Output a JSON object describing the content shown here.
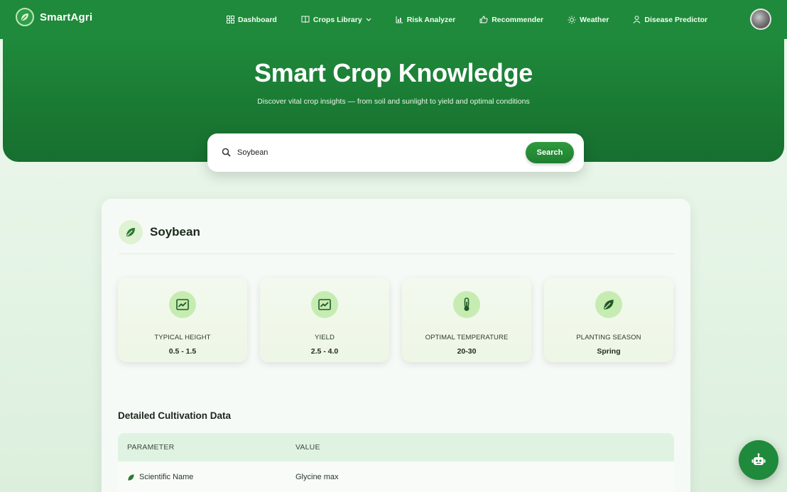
{
  "brand": {
    "name": "SmartAgri"
  },
  "nav": {
    "items": [
      {
        "id": "dashboard",
        "label": "Dashboard",
        "icon": "grid-icon"
      },
      {
        "id": "crops-library",
        "label": "Crops Library",
        "icon": "book-icon"
      },
      {
        "id": "risk-analyzer",
        "label": "Risk Analyzer",
        "icon": "chart-icon"
      },
      {
        "id": "recommender",
        "label": "Recommender",
        "icon": "thumbs-up-icon"
      },
      {
        "id": "weather",
        "label": "Weather",
        "icon": "sun-icon"
      },
      {
        "id": "disease-predictor",
        "label": "Disease Predictor",
        "icon": "user-icon"
      }
    ]
  },
  "hero": {
    "title": "Smart Crop Knowledge",
    "subtitle": "Discover vital crop insights — from soil and sunlight to yield and optimal conditions"
  },
  "search": {
    "value": "Soybean",
    "button_label": "Search"
  },
  "crop": {
    "name": "Soybean",
    "stats": [
      {
        "label": "TYPICAL HEIGHT",
        "value": "0.5 - 1.5",
        "icon": "trend-icon"
      },
      {
        "label": "YIELD",
        "value": "2.5 - 4.0",
        "icon": "trend-icon"
      },
      {
        "label": "OPTIMAL TEMPERATURE",
        "value": "20-30",
        "icon": "thermometer-icon"
      },
      {
        "label": "PLANTING SEASON",
        "value": "Spring",
        "icon": "leaf-icon"
      }
    ]
  },
  "details": {
    "title": "Detailed Cultivation Data",
    "columns": [
      "PARAMETER",
      "VALUE"
    ],
    "rows": [
      {
        "parameter": "Scientific Name",
        "value": "Glycine max"
      }
    ]
  },
  "colors": {
    "primary": "#1f8a3b",
    "accent_light": "#c6ecb2",
    "background": "#e3f3e4"
  }
}
